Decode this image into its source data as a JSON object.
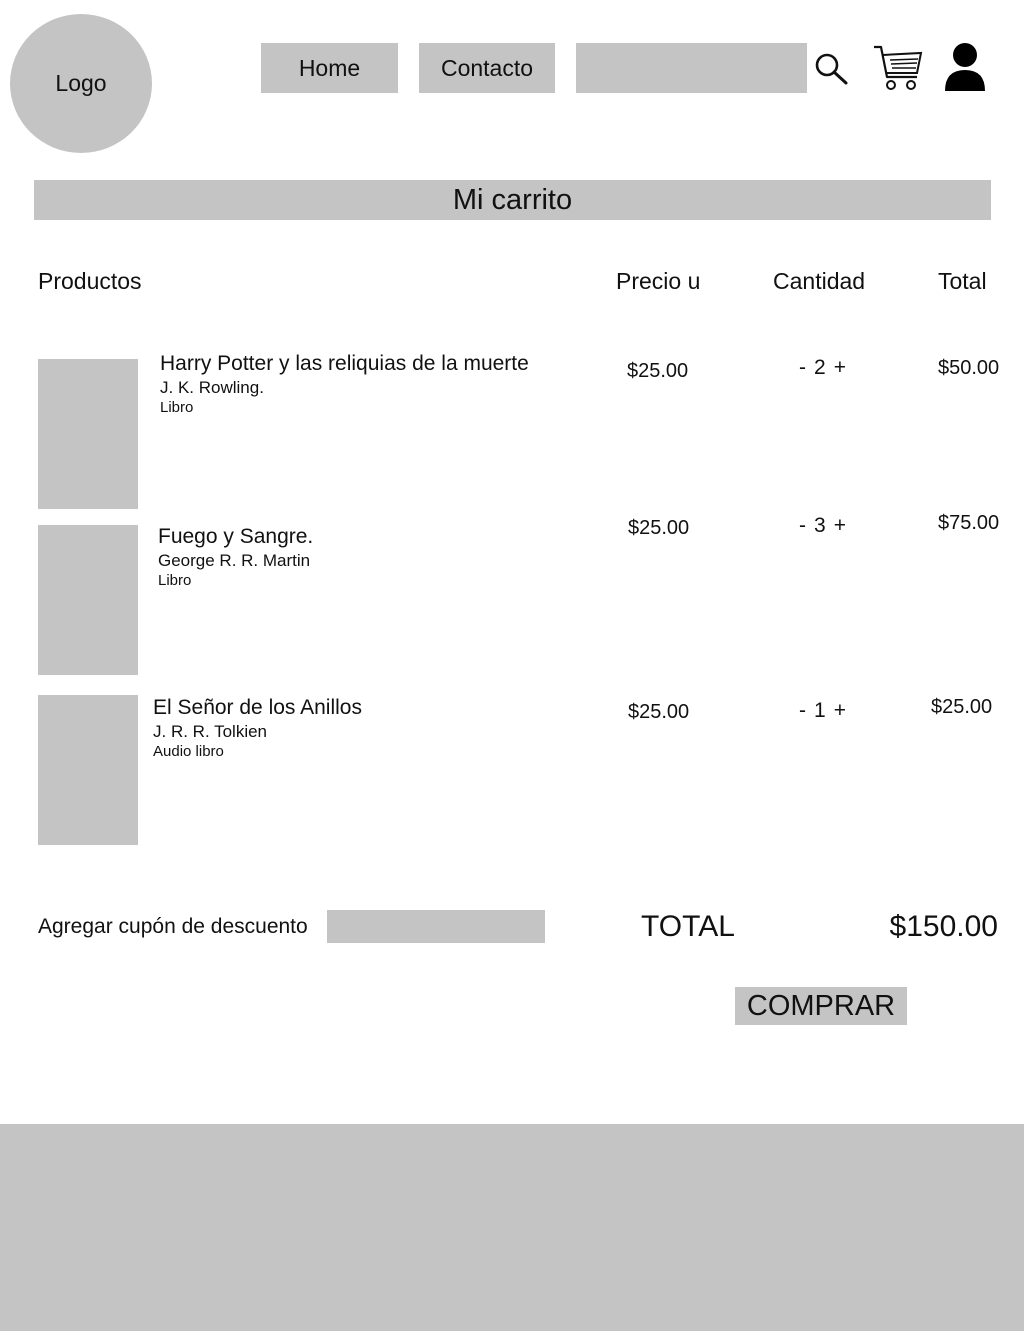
{
  "header": {
    "logo_text": "Logo",
    "nav": {
      "home": "Home",
      "contact": "Contacto"
    },
    "search_placeholder": "",
    "icons": {
      "search": "search-icon",
      "cart": "cart-icon",
      "user": "user-icon"
    }
  },
  "page_title": "Mi carrito",
  "columns": {
    "products": "Productos",
    "unit_price": "Precio u",
    "quantity": "Cantidad",
    "total": "Total"
  },
  "items": [
    {
      "title": "Harry Potter y las reliquias de la muerte",
      "author": "J. K. Rowling.",
      "format": "Libro",
      "unit_price": "$25.00",
      "quantity": "2",
      "line_total": "$50.00"
    },
    {
      "title": "Fuego y Sangre.",
      "author": "George R. R. Martin",
      "format": "Libro",
      "unit_price": "$25.00",
      "quantity": "3",
      "line_total": "$75.00"
    },
    {
      "title": "El Señor de los Anillos",
      "author": "J. R. R. Tolkien",
      "format": "Audio libro",
      "unit_price": "$25.00",
      "quantity": "1",
      "line_total": "$25.00"
    }
  ],
  "qty_controls": {
    "minus": "-",
    "plus": "+"
  },
  "coupon": {
    "label": "Agregar cupón de descuento",
    "placeholder": ""
  },
  "summary": {
    "total_label": "TOTAL",
    "total_value": "$150.00"
  },
  "buy_button": "COMPRAR",
  "colors": {
    "placeholder_gray": "#c4c4c4",
    "text": "#111111",
    "background": "#ffffff"
  }
}
